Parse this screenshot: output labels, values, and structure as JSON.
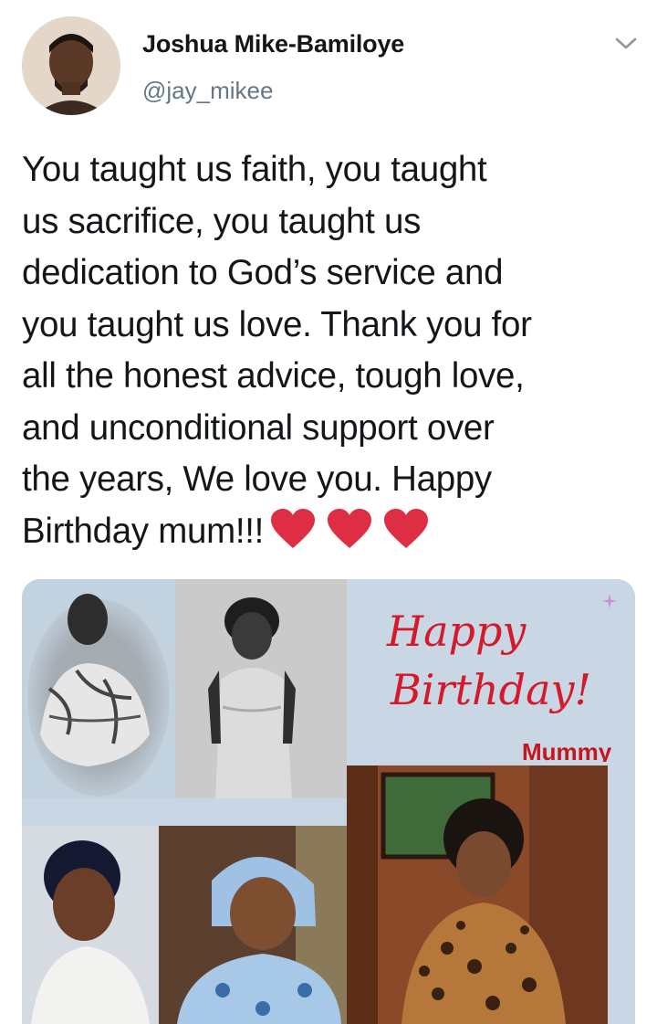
{
  "tweet": {
    "author": {
      "display_name": "Joshua Mike-Bamiloye",
      "handle": "@jay_mikee"
    },
    "text_lines": [
      "You taught us faith, you taught",
      "us sacrifice, you taught us",
      "dedication to God’s service and",
      "you taught us love. Thank you for",
      "all the honest advice, tough love,",
      "and unconditional support over",
      "the years, We love you. Happy",
      "Birthday mum!!!"
    ],
    "emoji": [
      "red-heart",
      "red-heart",
      "red-heart"
    ],
    "media": {
      "greeting_line1": "Happy",
      "greeting_line2": "Birthday!",
      "greeting_name": "Mummy"
    }
  },
  "colors": {
    "text": "#14171a",
    "secondary": "#657786",
    "heart": "#dd2e44",
    "greeting": "#d41a2a",
    "media_bg": "#c9d6e3"
  }
}
